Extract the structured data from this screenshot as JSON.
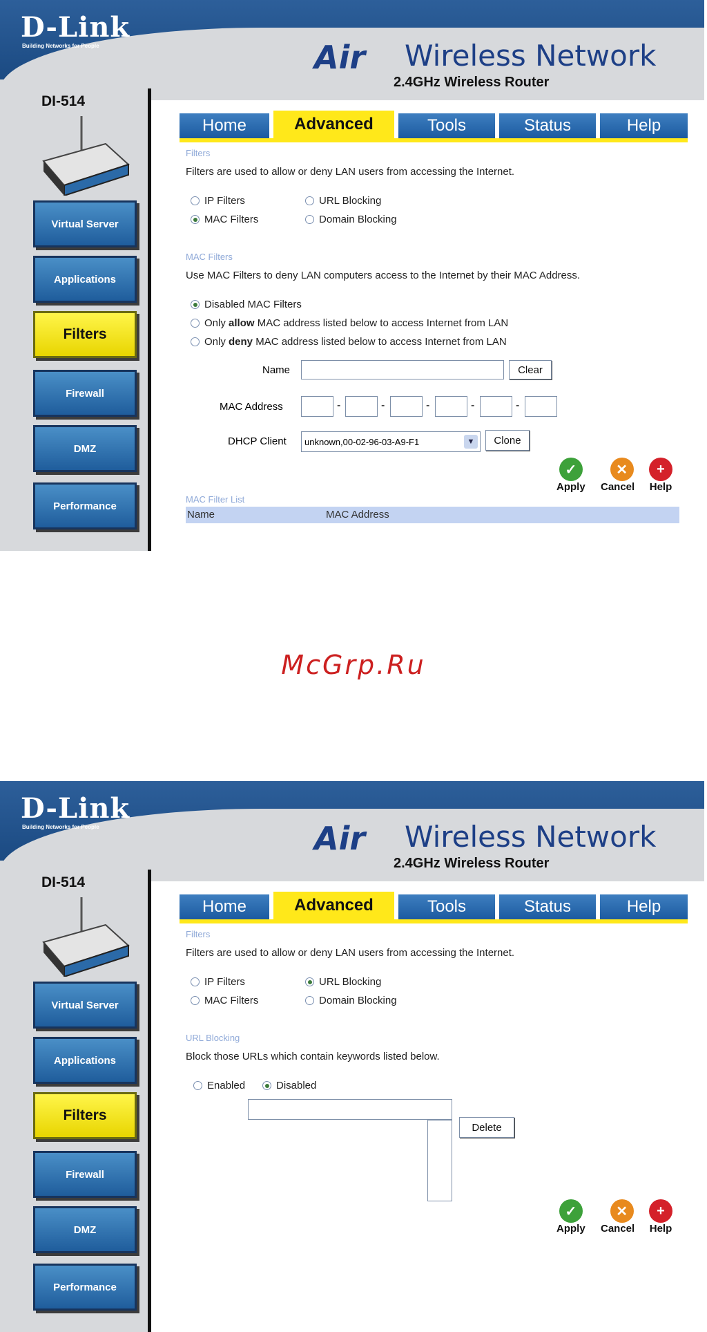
{
  "screens": [
    {
      "brand": {
        "logo": "D-Link",
        "tagline": "Building Networks for People"
      },
      "header": {
        "air": "Air",
        "wireless": "Wireless Network",
        "subtitle": "2.4GHz Wireless Router"
      },
      "model": "DI-514",
      "nav": [
        "Virtual Server",
        "Applications",
        "Filters",
        "Firewall",
        "DMZ",
        "Performance"
      ],
      "tabs": [
        "Home",
        "Advanced",
        "Tools",
        "Status",
        "Help"
      ],
      "filters": {
        "heading": "Filters",
        "description": "Filters are used to allow or deny LAN users from accessing the Internet.",
        "options": [
          "IP Filters",
          "URL Blocking",
          "MAC Filters",
          "Domain Blocking"
        ],
        "selected": "MAC Filters"
      },
      "mac": {
        "heading": "MAC Filters",
        "description": "Use MAC Filters to deny LAN computers access to the Internet by their MAC Address.",
        "mode_disabled": "Disabled MAC Filters",
        "mode_allow_prefix": "Only",
        "mode_allow_bold": "allow",
        "mode_allow_suffix": "MAC address listed below to access Internet from LAN",
        "mode_deny_prefix": "Only",
        "mode_deny_bold": "deny",
        "mode_deny_suffix": "MAC address listed below to access Internet from LAN",
        "name_label": "Name",
        "name_value": "",
        "clear": "Clear",
        "mac_label": "MAC Address",
        "dhcp_label": "DHCP Client",
        "dhcp_value": "unknown,00-02-96-03-A9-F1",
        "clone": "Clone",
        "list_heading": "MAC Filter List",
        "col_name": "Name",
        "col_mac": "MAC Address"
      },
      "actions": {
        "apply": "Apply",
        "cancel": "Cancel",
        "help": "Help"
      }
    },
    {
      "brand": {
        "logo": "D-Link",
        "tagline": "Building Networks for People"
      },
      "header": {
        "air": "Air",
        "wireless": "Wireless Network",
        "subtitle": "2.4GHz Wireless Router"
      },
      "model": "DI-514",
      "nav": [
        "Virtual Server",
        "Applications",
        "Filters",
        "Firewall",
        "DMZ",
        "Performance"
      ],
      "tabs": [
        "Home",
        "Advanced",
        "Tools",
        "Status",
        "Help"
      ],
      "filters": {
        "heading": "Filters",
        "description": "Filters are used to allow or deny LAN users from accessing the Internet.",
        "options": [
          "IP Filters",
          "URL Blocking",
          "MAC Filters",
          "Domain Blocking"
        ],
        "selected": "URL Blocking"
      },
      "url": {
        "heading": "URL Blocking",
        "description": "Block those URLs which contain keywords listed below.",
        "enabled": "Enabled",
        "disabled": "Disabled",
        "state": "Disabled",
        "keyword_value": "",
        "delete": "Delete"
      },
      "actions": {
        "apply": "Apply",
        "cancel": "Cancel",
        "help": "Help"
      }
    }
  ],
  "watermark": "McGrp.Ru",
  "colors": {
    "tab_blue": "#1c5aa0",
    "active_yellow": "#ffe81a",
    "apply_green": "#3da13a",
    "cancel_orange": "#e88a1e",
    "help_red": "#d4212a"
  }
}
